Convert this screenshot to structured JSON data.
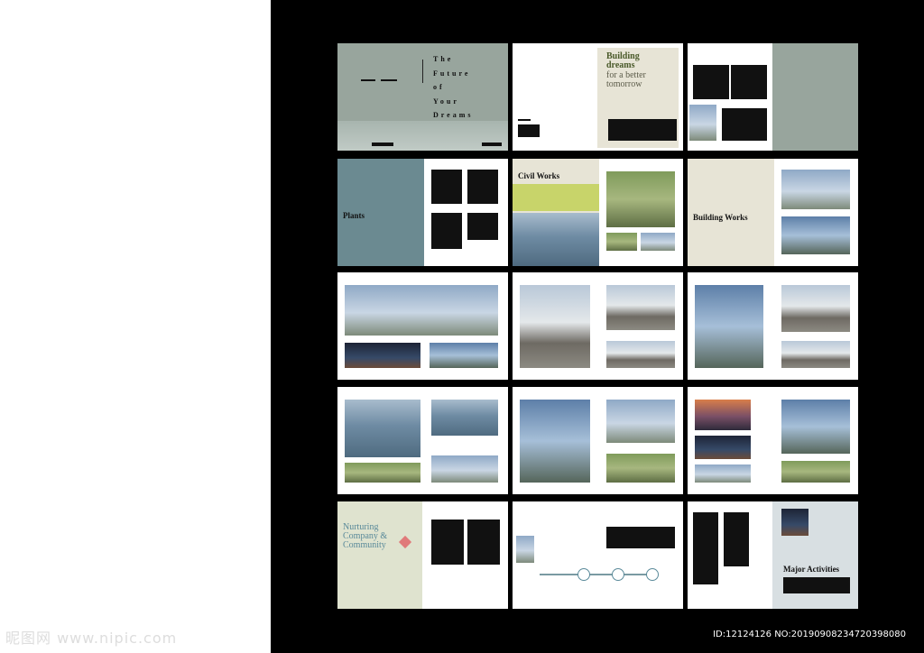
{
  "cover": {
    "title_lines": [
      "The",
      "Future",
      "of",
      "Your",
      "Dreams"
    ]
  },
  "spread2": {
    "heading": [
      "Building",
      "dreams"
    ],
    "subheading": [
      "for a better",
      "tomorrow"
    ]
  },
  "spread5": {
    "section": "Plants"
  },
  "spread6": {
    "section": "Civil Works"
  },
  "spread7": {
    "section": "Building Works"
  },
  "spread13": {
    "heading": [
      "Nurturing",
      "Company &",
      "Community"
    ]
  },
  "spread15": {
    "heading": "Major Activities"
  },
  "watermark": "昵图网 www.nipic.com",
  "id_line": "ID:12124126 NO:20190908234720398080",
  "colors": {
    "sage": "#98a59d",
    "olive_heading": "#4a5a2a",
    "teal_heading": "#5a8a9a",
    "lime": "#c8d46a"
  }
}
